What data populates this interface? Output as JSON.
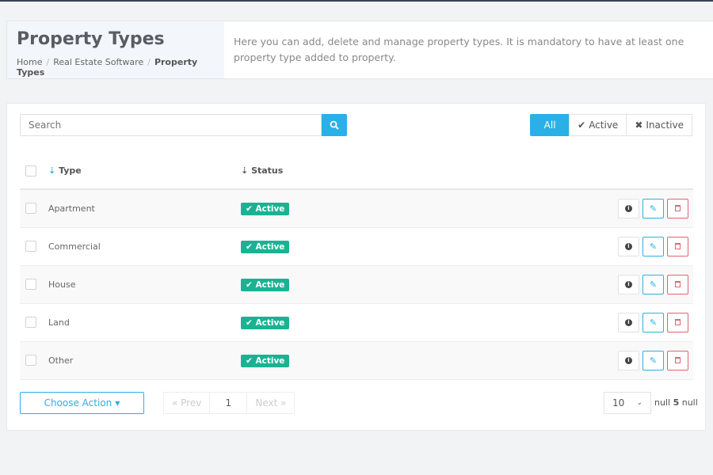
{
  "header": {
    "title": "Property Types",
    "breadcrumb": [
      "Home",
      "Real Estate Software",
      "Property Types"
    ],
    "description": "Here you can add, delete and manage property types. It is mandatory to have at least one property type added to property."
  },
  "search": {
    "placeholder": "Search"
  },
  "filters": {
    "all": "All",
    "active": "Active",
    "inactive": "Inactive"
  },
  "columns": {
    "type": "Type",
    "status": "Status"
  },
  "rows": [
    {
      "type": "Apartment",
      "status": "Active"
    },
    {
      "type": "Commercial",
      "status": "Active"
    },
    {
      "type": "House",
      "status": "Active"
    },
    {
      "type": "Land",
      "status": "Active"
    },
    {
      "type": "Other",
      "status": "Active"
    }
  ],
  "footer": {
    "choose_action": "Choose Action",
    "prev": "« Prev",
    "page": "1",
    "next": "Next »",
    "per_page": "10",
    "count_prefix": "null",
    "count": "5",
    "count_suffix": "null"
  },
  "colors": {
    "accent": "#2ab0e6",
    "active": "#19b394",
    "danger": "#e26272"
  }
}
